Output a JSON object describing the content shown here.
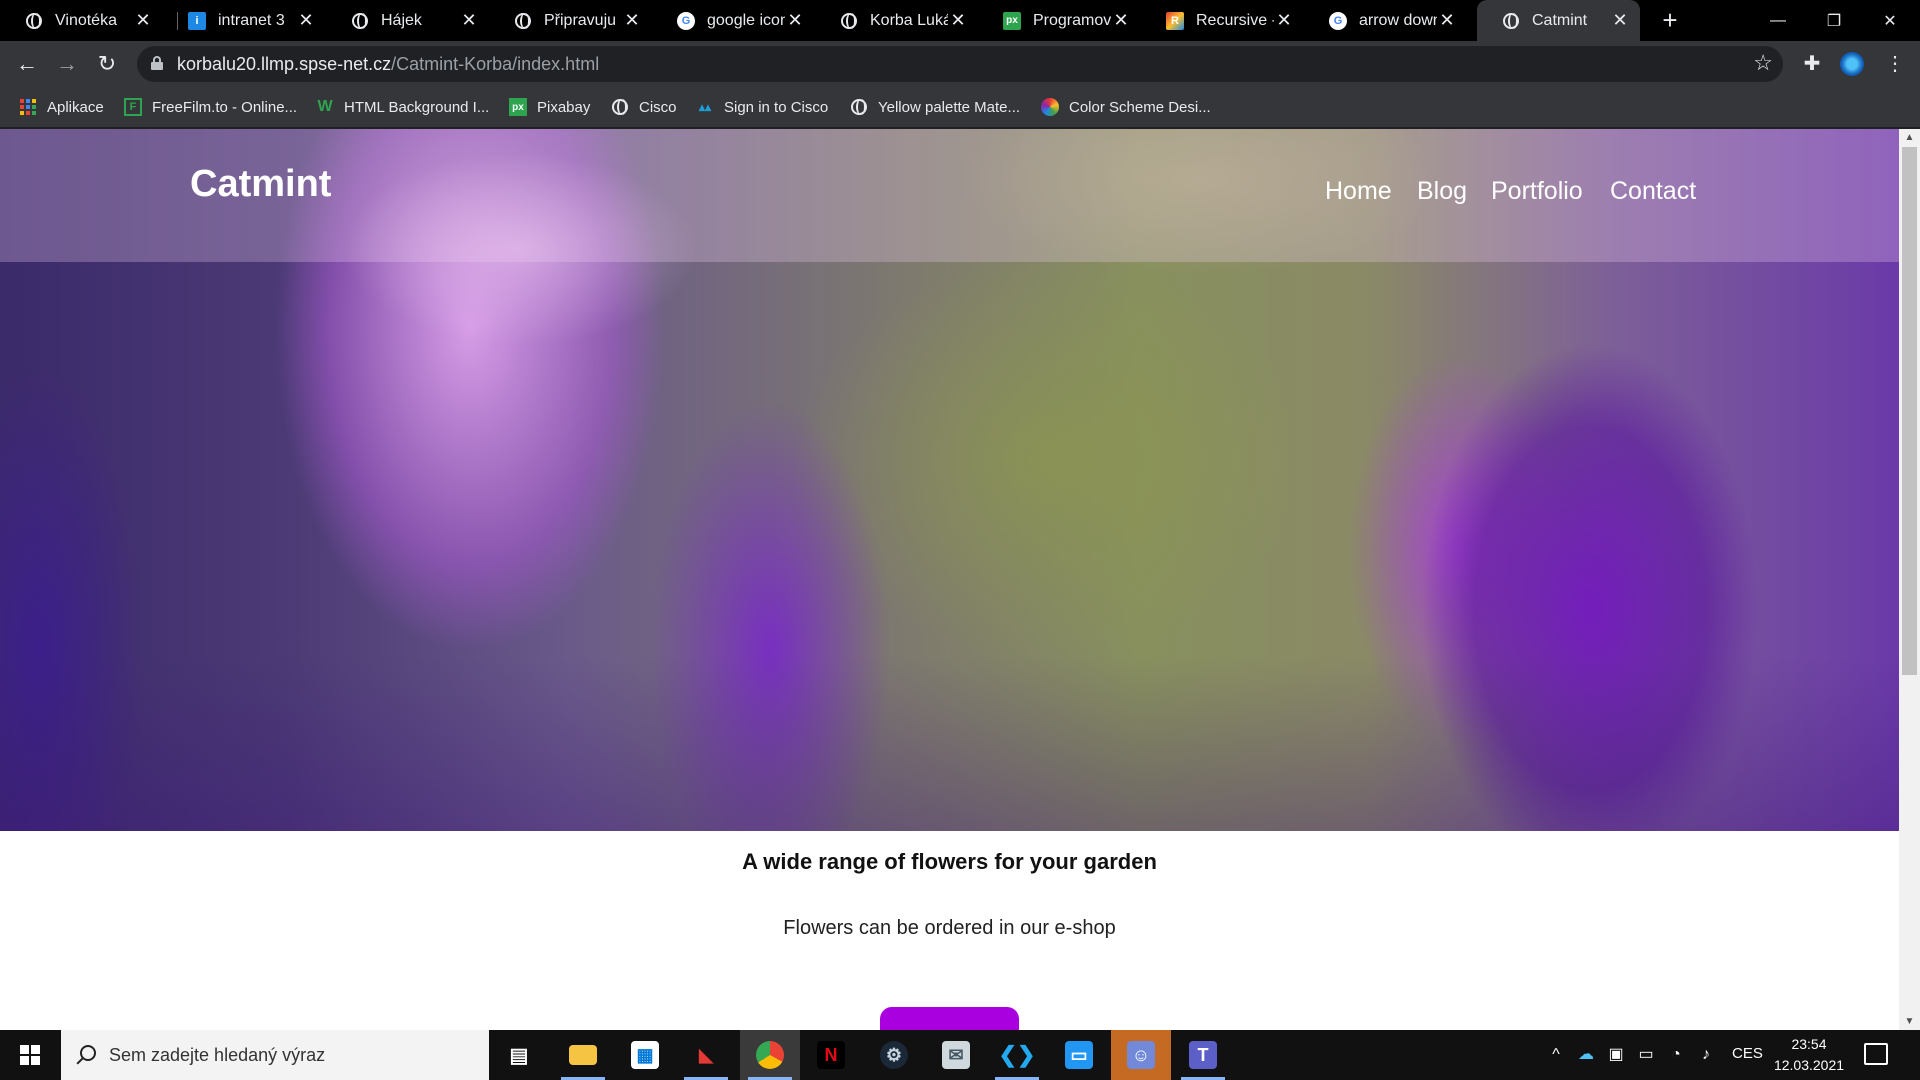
{
  "browser": {
    "tabs": [
      {
        "title": "Vinotéka",
        "favicon": "globe-icon",
        "active": false
      },
      {
        "title": "intranet 3",
        "favicon": "intranet-icon",
        "active": false
      },
      {
        "title": "Hájek",
        "favicon": "globe-icon",
        "active": false
      },
      {
        "title": "Připravuju",
        "favicon": "globe-icon",
        "active": false
      },
      {
        "title": "google icon",
        "favicon": "google-icon",
        "active": false
      },
      {
        "title": "Korba Lukáš",
        "favicon": "globe-icon",
        "active": false
      },
      {
        "title": "Programová",
        "favicon": "px-icon",
        "active": false
      },
      {
        "title": "Recursive - G",
        "favicon": "recursive-icon",
        "active": false
      },
      {
        "title": "arrow down",
        "favicon": "google-icon",
        "active": false
      },
      {
        "title": "Catmint",
        "favicon": "globe-icon",
        "active": true
      }
    ],
    "new_tab": "+",
    "window_controls": {
      "minimize": "—",
      "restore": "❐",
      "close": "✕"
    },
    "nav": {
      "back": "←",
      "forward": "→",
      "reload": "↻"
    },
    "address": {
      "host": "korbalu20.llmp.spse-net.cz",
      "path": "/Catmint-Korba/index.html"
    },
    "icons": {
      "star": "☆",
      "extensions": "✚",
      "menu": "⋮"
    },
    "bookmarks": [
      {
        "label": "Aplikace",
        "icon": "apps-grid-icon"
      },
      {
        "label": "FreeFilm.to - Online...",
        "icon": "freefilm-icon"
      },
      {
        "label": "HTML Background I...",
        "icon": "w-icon"
      },
      {
        "label": "Pixabay",
        "icon": "px-icon"
      },
      {
        "label": "Cisco",
        "icon": "globe-icon"
      },
      {
        "label": "Sign in to Cisco",
        "icon": "cisco-icon"
      },
      {
        "label": "Yellow palette Mate...",
        "icon": "globe-icon"
      },
      {
        "label": "Color Scheme Desi...",
        "icon": "color-scheme-icon"
      }
    ]
  },
  "page": {
    "logo": "Catmint",
    "nav": [
      "Home",
      "Blog",
      "Portfolio",
      "Contact"
    ],
    "subtitle": "A wide range of flowers for your garden",
    "description": "Flowers can be ordered in our e-shop",
    "accent_color": "#a900e0"
  },
  "taskbar": {
    "search_placeholder": "Sem zadejte hledaný výraz",
    "apps": [
      "task-view-icon",
      "file-explorer-icon",
      "store-icon",
      "game-icon",
      "chrome-icon",
      "netflix-icon",
      "steam-icon",
      "mail-icon",
      "vscode-icon",
      "news-icon",
      "discord-icon",
      "teams-icon"
    ],
    "tray": {
      "language": "CES",
      "time": "23:54",
      "date": "12.03.2021"
    }
  }
}
